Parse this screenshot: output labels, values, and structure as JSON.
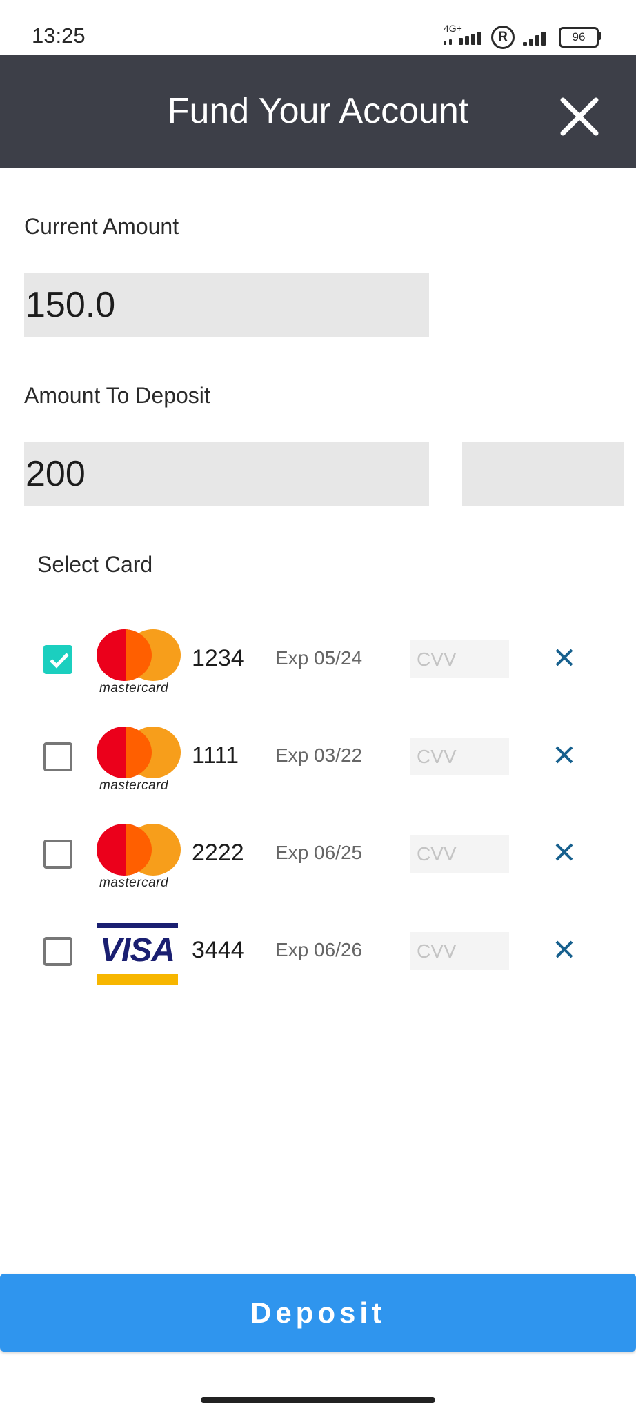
{
  "status_bar": {
    "time": "13:25",
    "network": "4G+",
    "battery": "96"
  },
  "header": {
    "title": "Fund Your Account",
    "close_icon": "close-icon",
    "background": "#3d3f48"
  },
  "form": {
    "current_amount_label": "Current Amount",
    "current_amount_value": "150.0",
    "deposit_label": "Amount To Deposit",
    "deposit_value": "200",
    "select_card_label": "Select Card"
  },
  "cards": [
    {
      "brand": "mastercard",
      "brand_text": "mastercard",
      "number": "1234",
      "exp": "Exp 05/24",
      "cvv_placeholder": "CVV",
      "selected": true
    },
    {
      "brand": "mastercard",
      "brand_text": "mastercard",
      "number": "1111",
      "exp": "Exp 03/22",
      "cvv_placeholder": "CVV",
      "selected": false
    },
    {
      "brand": "mastercard",
      "brand_text": "mastercard",
      "number": "2222",
      "exp": "Exp 06/25",
      "cvv_placeholder": "CVV",
      "selected": false
    },
    {
      "brand": "visa",
      "brand_text": "VISA",
      "number": "3444",
      "exp": "Exp 06/26",
      "cvv_placeholder": "CVV",
      "selected": false
    }
  ],
  "actions": {
    "deposit_label": "Deposit",
    "accent": "#2f95ee",
    "check_color": "#1bcfbf",
    "remove_color": "#17608e"
  }
}
